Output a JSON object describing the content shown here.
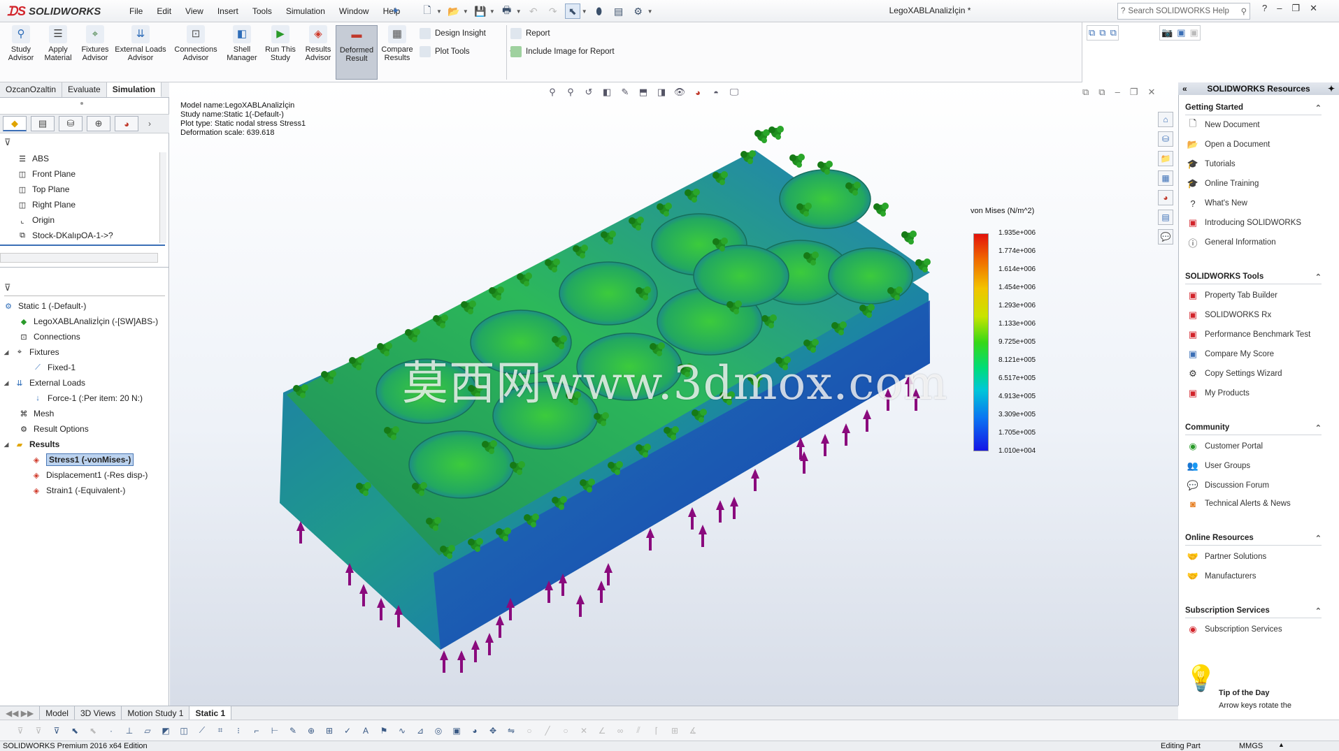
{
  "app": {
    "brand": "SOLIDWORKS",
    "document_title": "LegoXABLAnalizİçin *"
  },
  "menu": [
    "File",
    "Edit",
    "View",
    "Insert",
    "Tools",
    "Simulation",
    "Window",
    "Help"
  ],
  "search": {
    "placeholder": "Search SOLIDWORKS Help"
  },
  "commands": {
    "study_advisor": "Study\nAdvisor",
    "apply_material": "Apply\nMaterial",
    "fixtures_advisor": "Fixtures\nAdvisor",
    "external_loads": "External Loads\nAdvisor",
    "connections_advisor": "Connections\nAdvisor",
    "shell_manager": "Shell\nManager",
    "run_study": "Run This\nStudy",
    "results_advisor": "Results\nAdvisor",
    "deformed_result": "Deformed\nResult",
    "compare_results": "Compare\nResults",
    "design_insight": "Design Insight",
    "plot_tools": "Plot Tools",
    "report": "Report",
    "include_image": "Include Image for Report"
  },
  "cm_tabs": [
    "OzcanOzaltin",
    "Evaluate",
    "Simulation"
  ],
  "feature_tree": [
    "ABS",
    "Front Plane",
    "Top Plane",
    "Right Plane",
    "Origin",
    "Stock-DKalıpOA-1->?"
  ],
  "sim_tree": {
    "study": "Static 1 (-Default-)",
    "part": "LegoXABLAnalizİçin (-[SW]ABS-)",
    "connections": "Connections",
    "fixtures": "Fixtures",
    "fixed": "Fixed-1",
    "external_loads": "External Loads",
    "force": "Force-1 (:Per item: 20 N:)",
    "mesh": "Mesh",
    "result_options": "Result Options",
    "results": "Results",
    "stress": "Stress1 (-vonMises-)",
    "displacement": "Displacement1 (-Res disp-)",
    "strain": "Strain1 (-Equivalent-)"
  },
  "plot_info": {
    "model": "Model name:LegoXABLAnalizİçin",
    "study": "Study name:Static 1(-Default-)",
    "plot": "Plot type: Static nodal stress Stress1",
    "scale": "Deformation scale: 639.618"
  },
  "legend": {
    "title": "von Mises (N/m^2)",
    "values": [
      "1.935e+006",
      "1.774e+006",
      "1.614e+006",
      "1.454e+006",
      "1.293e+006",
      "1.133e+006",
      "9.725e+005",
      "8.121e+005",
      "6.517e+005",
      "4.913e+005",
      "3.309e+005",
      "1.705e+005",
      "1.010e+004"
    ]
  },
  "watermark": "莫西网www.3dmox.com",
  "taskpane": {
    "title": "SOLIDWORKS Resources",
    "getting_started": "Getting Started",
    "gs_items": [
      "New Document",
      "Open a Document",
      "Tutorials",
      "Online Training",
      "What's New",
      "Introducing SOLIDWORKS",
      "General Information"
    ],
    "tools": "SOLIDWORKS Tools",
    "tool_items": [
      "Property Tab Builder",
      "SOLIDWORKS Rx",
      "Performance Benchmark Test",
      "Compare My Score",
      "Copy Settings Wizard",
      "My Products"
    ],
    "community": "Community",
    "community_items": [
      "Customer Portal",
      "User Groups",
      "Discussion Forum",
      "Technical Alerts & News"
    ],
    "online": "Online Resources",
    "online_items": [
      "Partner Solutions",
      "Manufacturers"
    ],
    "subscription": "Subscription Services",
    "subscription_items": [
      "Subscription Services"
    ],
    "tip_title": "Tip of the Day",
    "tip_text": "Arrow keys rotate the"
  },
  "bottom_tabs": [
    "Model",
    "3D Views",
    "Motion Study 1",
    "Static 1"
  ],
  "status": {
    "edition": "SOLIDWORKS Premium 2016 x64 Edition",
    "mode": "Editing Part",
    "units": "MMGS"
  },
  "colors": {
    "accent": "#3b6fb6",
    "brand": "#d2232a",
    "force_arrow": "#8a0a7d",
    "fixture_green": "#1e8a1e"
  }
}
